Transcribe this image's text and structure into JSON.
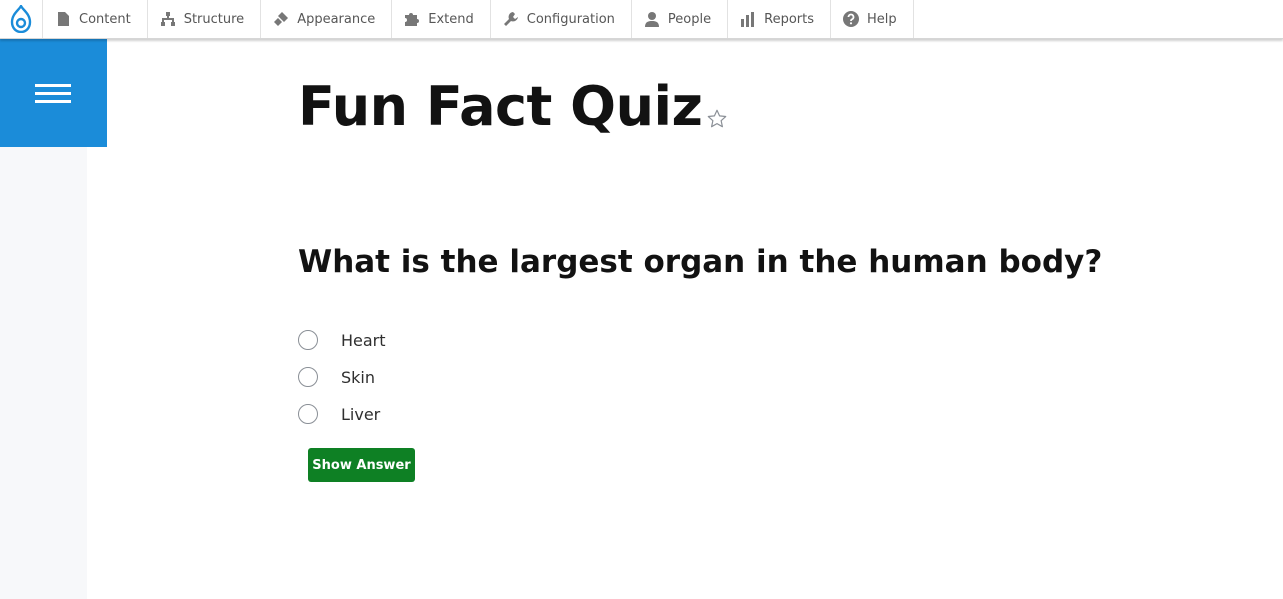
{
  "toolbar": {
    "logo_icon": "drupal-drop-icon",
    "items": [
      {
        "label": "Content",
        "icon": "file-icon"
      },
      {
        "label": "Structure",
        "icon": "sitemap-icon"
      },
      {
        "label": "Appearance",
        "icon": "paintbrush-icon"
      },
      {
        "label": "Extend",
        "icon": "puzzle-icon"
      },
      {
        "label": "Configuration",
        "icon": "wrench-icon"
      },
      {
        "label": "People",
        "icon": "person-icon"
      },
      {
        "label": "Reports",
        "icon": "bar-chart-icon"
      },
      {
        "label": "Help",
        "icon": "question-circle-icon"
      }
    ]
  },
  "sidebar": {
    "menu_icon": "hamburger-menu-icon",
    "accent_color": "#1b8cd9"
  },
  "page": {
    "title": "Fun Fact Quiz",
    "favorite_icon": "star-outline-icon"
  },
  "quiz": {
    "question": "What is the largest organ in the human body?",
    "options": [
      {
        "label": "Heart",
        "selected": false
      },
      {
        "label": "Skin",
        "selected": false
      },
      {
        "label": "Liver",
        "selected": false
      }
    ],
    "button_label": "Show Answer",
    "button_color": "#0e8024"
  }
}
